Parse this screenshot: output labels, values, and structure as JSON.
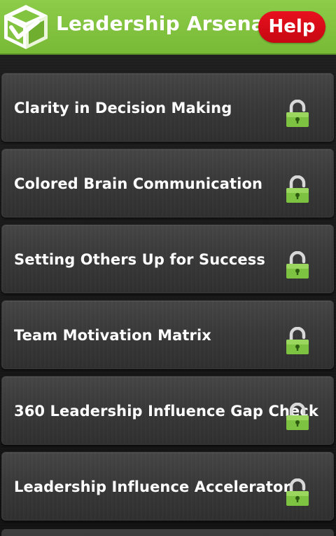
{
  "header": {
    "title": "Leadership Arsenal",
    "help_label": "Help",
    "logo": "green-cube-logo",
    "accent_color": "#7dbf3a",
    "help_color": "#d90d17"
  },
  "list": {
    "items": [
      {
        "label": "Clarity in Decision Making",
        "icon": "lock-icon",
        "locked": true
      },
      {
        "label": "Colored Brain Communication",
        "icon": "lock-icon",
        "locked": true
      },
      {
        "label": "Setting Others Up for Success",
        "icon": "lock-icon",
        "locked": true
      },
      {
        "label": "Team Motivation Matrix",
        "icon": "lock-icon",
        "locked": true
      },
      {
        "label": "360 Leadership Influence Gap Check",
        "icon": "lock-icon",
        "locked": true
      },
      {
        "label": "Leadership Influence Accelerator",
        "icon": "lock-icon",
        "locked": true
      }
    ]
  }
}
